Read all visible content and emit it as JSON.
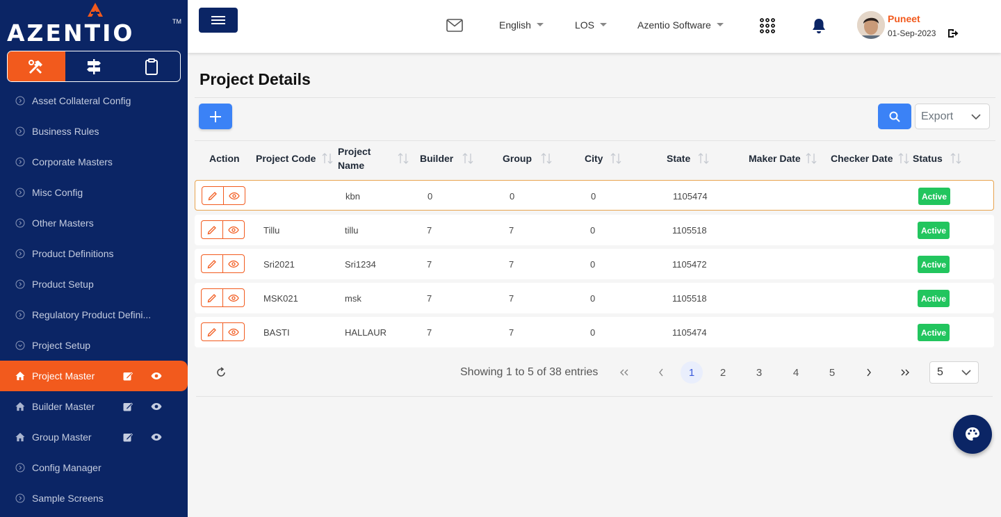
{
  "brand": {
    "name": "AZENTIO",
    "tm": "TM"
  },
  "sidebar": {
    "mode_tabs": [
      {
        "icon": "tools-icon",
        "active": true
      },
      {
        "icon": "signpost-icon",
        "active": false
      },
      {
        "icon": "clipboard-icon",
        "active": false
      }
    ],
    "items": [
      {
        "label": "Asset Collateral Config"
      },
      {
        "label": "Business Rules"
      },
      {
        "label": "Corporate Masters"
      },
      {
        "label": "Misc Config"
      },
      {
        "label": "Other Masters"
      },
      {
        "label": "Product Definitions"
      },
      {
        "label": "Product Setup"
      },
      {
        "label": "Regulatory Product Defini..."
      },
      {
        "label": "Project Setup"
      },
      {
        "label": "Project Master"
      },
      {
        "label": "Builder Master"
      },
      {
        "label": "Group Master"
      },
      {
        "label": "Config Manager"
      },
      {
        "label": "Sample Screens"
      }
    ]
  },
  "topbar": {
    "language": "English",
    "module": "LOS",
    "company": "Azentio Software",
    "user_name": "Puneet",
    "user_date": "01-Sep-2023"
  },
  "page": {
    "title": "Project Details",
    "export_label": "Export"
  },
  "table": {
    "headers": {
      "action": "Action",
      "code": "Project Code",
      "name": "Project Name",
      "builder": "Builder",
      "group": "Group",
      "city": "City",
      "state": "State",
      "maker": "Maker Date",
      "checker": "Checker Date",
      "status": "Status"
    },
    "rows": [
      {
        "code": "",
        "name": "kbn",
        "builder": "0",
        "group": "0",
        "city": "0",
        "state": "1105474",
        "maker": "",
        "checker": "",
        "status": "Active"
      },
      {
        "code": "Tillu",
        "name": "tillu",
        "builder": "7",
        "group": "7",
        "city": "0",
        "state": "1105518",
        "maker": "",
        "checker": "",
        "status": "Active"
      },
      {
        "code": "Sri2021",
        "name": "Sri1234",
        "builder": "7",
        "group": "7",
        "city": "0",
        "state": "1105472",
        "maker": "",
        "checker": "",
        "status": "Active"
      },
      {
        "code": "MSK021",
        "name": "msk",
        "builder": "7",
        "group": "7",
        "city": "0",
        "state": "1105518",
        "maker": "",
        "checker": "",
        "status": "Active"
      },
      {
        "code": "BASTI",
        "name": "HALLAUR",
        "builder": "7",
        "group": "7",
        "city": "0",
        "state": "1105474",
        "maker": "",
        "checker": "",
        "status": "Active"
      }
    ]
  },
  "pagination": {
    "showing": "Showing 1 to 5 of 38 entries",
    "pages": [
      "1",
      "2",
      "3",
      "4",
      "5"
    ],
    "current_page": "1",
    "rows_per_page": "5"
  },
  "colors": {
    "sidebar_bg": "#0b2565",
    "accent": "#f25a1d",
    "primary": "#3b82f6",
    "status_active": "#22c55e"
  }
}
